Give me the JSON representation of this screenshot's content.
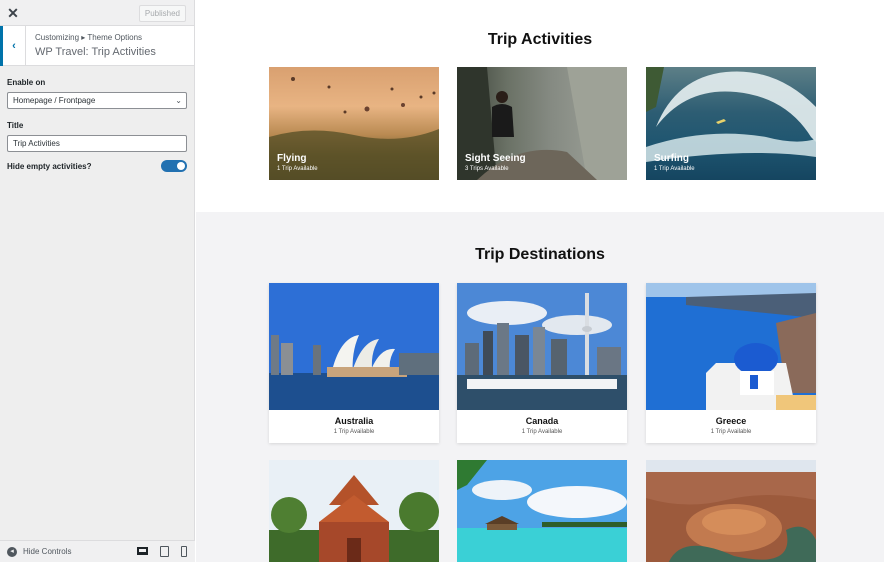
{
  "customizer": {
    "close_icon": "close-icon",
    "published_label": "Published",
    "breadcrumb": "Customizing ▸ Theme Options",
    "section_title": "WP Travel: Trip Activities",
    "enable_on_label": "Enable on",
    "enable_on_value": "Homepage / Frontpage",
    "title_label": "Title",
    "title_value": "Trip Activities",
    "hide_empty_label": "Hide empty activities?",
    "hide_empty_enabled": true,
    "hide_controls_label": "Hide Controls",
    "accent_color": "#2271b1"
  },
  "preview": {
    "activities_heading": "Trip Activities",
    "activities": [
      {
        "name": "Flying",
        "count": "1 Trip Available"
      },
      {
        "name": "Sight Seeing",
        "count": "3 Trips Available"
      },
      {
        "name": "Surfing",
        "count": "1 Trip Available"
      }
    ],
    "destinations_heading": "Trip Destinations",
    "destinations": [
      {
        "name": "Australia",
        "count": "1 Trip Available"
      },
      {
        "name": "Canada",
        "count": "1 Trip Available"
      },
      {
        "name": "Greece",
        "count": "1 Trip Available"
      }
    ]
  }
}
